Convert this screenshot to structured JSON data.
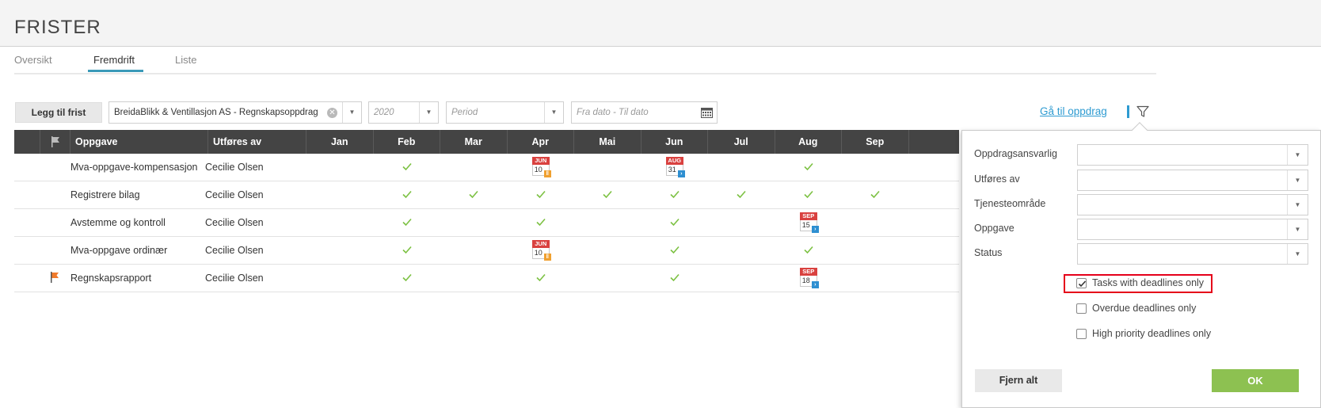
{
  "page": {
    "title": "FRISTER"
  },
  "tabs": [
    {
      "label": "Oversikt",
      "active": false
    },
    {
      "label": "Fremdrift",
      "active": true
    },
    {
      "label": "Liste",
      "active": false
    }
  ],
  "toolbar": {
    "add_label": "Legg til frist",
    "client_value": "BreidaBlikk & Ventillasjon AS - Regnskapsoppdrag",
    "year_value": "2020",
    "period_placeholder": "Period",
    "date_placeholder": "Fra dato - Til dato",
    "goto_label": "Gå til oppdrag"
  },
  "grid": {
    "columns": {
      "task": "Oppgave",
      "performer": "Utføres av"
    },
    "months": [
      "Jan",
      "Feb",
      "Mar",
      "Apr",
      "Mai",
      "Jun",
      "Jul",
      "Aug",
      "Sep"
    ],
    "rows": [
      {
        "task": "Mva-oppgave-kompensasjon",
        "performer": "Cecilie Olsen",
        "flagged": false,
        "months": [
          "",
          "check",
          "",
          "deadline",
          "",
          "deadline",
          "",
          "check",
          ""
        ],
        "deadlines": [
          {
            "month_index": 3,
            "mon": "JUN",
            "day": "10",
            "status": "orange"
          },
          {
            "month_index": 5,
            "mon": "AUG",
            "day": "31",
            "status": "blue"
          }
        ]
      },
      {
        "task": "Registrere bilag",
        "performer": "Cecilie Olsen",
        "flagged": false,
        "months": [
          "",
          "check",
          "check",
          "check",
          "check",
          "check",
          "check",
          "check",
          "check"
        ],
        "deadlines": []
      },
      {
        "task": "Avstemme og kontroll",
        "performer": "Cecilie Olsen",
        "flagged": false,
        "months": [
          "",
          "check",
          "",
          "check",
          "",
          "check",
          "",
          "deadline",
          ""
        ],
        "deadlines": [
          {
            "month_index": 7,
            "mon": "SEP",
            "day": "15",
            "status": "blue"
          }
        ]
      },
      {
        "task": "Mva-oppgave ordinær",
        "performer": "Cecilie Olsen",
        "flagged": false,
        "months": [
          "",
          "check",
          "",
          "deadline",
          "",
          "check",
          "",
          "check",
          ""
        ],
        "deadlines": [
          {
            "month_index": 3,
            "mon": "JUN",
            "day": "10",
            "status": "orange"
          }
        ]
      },
      {
        "task": "Regnskapsrapport",
        "performer": "Cecilie Olsen",
        "flagged": true,
        "months": [
          "",
          "check",
          "",
          "check",
          "",
          "check",
          "",
          "deadline",
          ""
        ],
        "deadlines": [
          {
            "month_index": 7,
            "mon": "SEP",
            "day": "18",
            "status": "blue"
          }
        ]
      }
    ]
  },
  "filter": {
    "fields": [
      "Oppdragsansvarlig",
      "Utføres av",
      "Tjenesteområde",
      "Oppgave",
      "Status"
    ],
    "checkboxes": [
      {
        "label": "Tasks with deadlines only",
        "checked": true
      },
      {
        "label": "Overdue deadlines only",
        "checked": false
      },
      {
        "label": "High priority deadlines only",
        "checked": false
      }
    ],
    "clear_label": "Fjern alt",
    "ok_label": "OK"
  },
  "colors": {
    "header_bg": "#444444",
    "accent_blue": "#2e9bd1",
    "check_green": "#7cc142",
    "ok_green": "#8dc151",
    "flag_orange": "#f07a2b",
    "badge_red": "#d9413f",
    "status_orange": "#f0a030",
    "status_blue": "#2e8fd1",
    "highlight_red": "#e5001a"
  }
}
